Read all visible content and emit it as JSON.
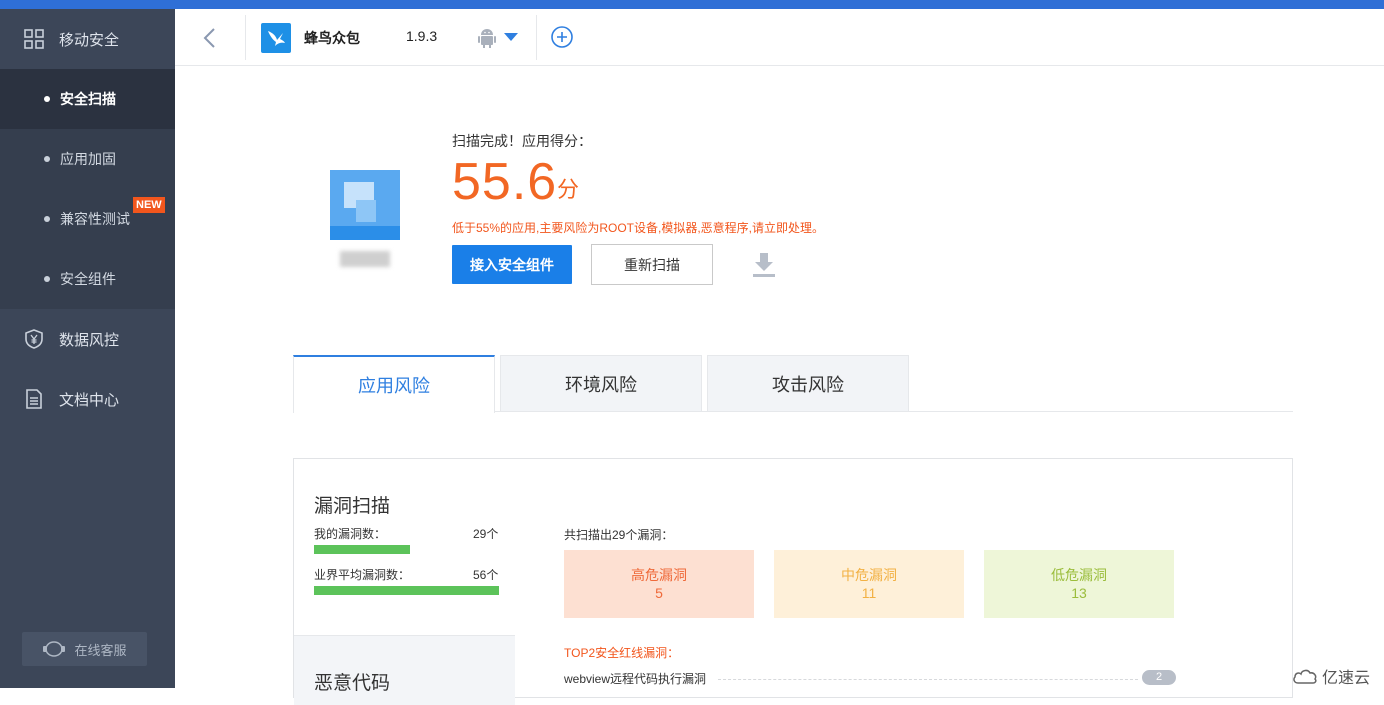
{
  "sidebar": {
    "sections": [
      {
        "label": "移动安全",
        "icon": "grid-icon"
      },
      {
        "label": "数据风控",
        "icon": "shield-yen-icon"
      },
      {
        "label": "文档中心",
        "icon": "document-icon"
      }
    ],
    "sub_items": [
      {
        "label": "安全扫描",
        "active": true
      },
      {
        "label": "应用加固",
        "active": false
      },
      {
        "label": "兼容性测试",
        "active": false,
        "badge": "NEW"
      },
      {
        "label": "安全组件",
        "active": false
      }
    ],
    "service_label": "在线客服"
  },
  "header": {
    "app_name": "蜂鸟众包",
    "version": "1.9.3",
    "platform_icon": "android-icon"
  },
  "score": {
    "status": "扫描完成！应用得分：",
    "value": "55.6",
    "unit": "分",
    "note": "低于55%的应用,主要风险为ROOT设备,模拟器,恶意程序,请立即处理。",
    "primary_button": "接入安全组件",
    "rescan_button": "重新扫描"
  },
  "tabs": [
    {
      "label": "应用风险",
      "active": true
    },
    {
      "label": "环境风险",
      "active": false
    },
    {
      "label": "攻击风险",
      "active": false
    }
  ],
  "vuln_scan": {
    "title": "漏洞扫描",
    "my_label": "我的漏洞数：",
    "my_count": "29个",
    "my_value": 29,
    "avg_label": "业界平均漏洞数：",
    "avg_count": "56个",
    "avg_value": 56,
    "found_text": "共扫描出29个漏洞：",
    "severity": [
      {
        "label": "高危漏洞",
        "count": "5"
      },
      {
        "label": "中危漏洞",
        "count": "11"
      },
      {
        "label": "低危漏洞",
        "count": "13"
      }
    ],
    "top2_title": "TOP2安全红线漏洞：",
    "top_items": [
      {
        "label": "webview远程代码执行漏洞",
        "count": "2"
      }
    ]
  },
  "malicious": {
    "title": "恶意代码"
  },
  "watermark": "亿速云",
  "colors": {
    "sidebar_bg": "#3c4658",
    "accent": "#1a7fe8",
    "score": "#f26724"
  }
}
